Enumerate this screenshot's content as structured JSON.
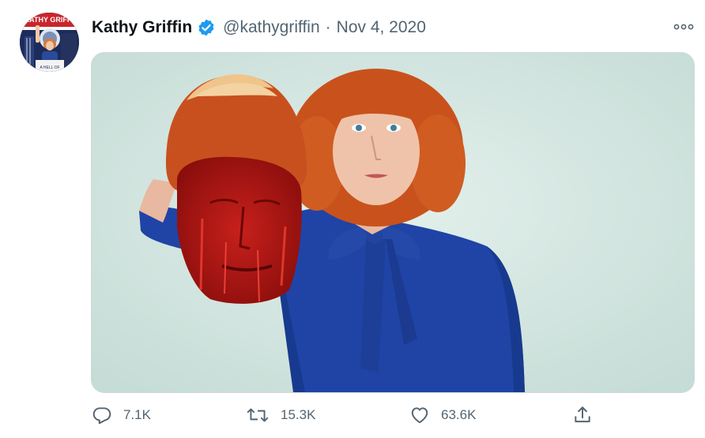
{
  "tweet": {
    "author": {
      "display_name": "Kathy Griffin",
      "handle": "@kathygriffin",
      "verified": true,
      "avatar_icon": "profile-photo",
      "avatar_sign_text": "KATHY GRIFFIN",
      "avatar_podium_text": "A HELL OF"
    },
    "separator": "·",
    "date": "Nov 4, 2020",
    "more_icon": "more-dots-icon",
    "media": {
      "kind": "photo",
      "background_color": "#cfe3de"
    },
    "actions": {
      "reply": {
        "icon": "reply-icon",
        "count": "7.1K"
      },
      "retweet": {
        "icon": "retweet-icon",
        "count": "15.3K"
      },
      "like": {
        "icon": "heart-icon",
        "count": "63.6K"
      },
      "share": {
        "icon": "share-icon"
      }
    },
    "colors": {
      "text_primary": "#0f1419",
      "text_secondary": "#536471",
      "verified_blue": "#1d9bf0",
      "border": "#cfd9de"
    }
  }
}
